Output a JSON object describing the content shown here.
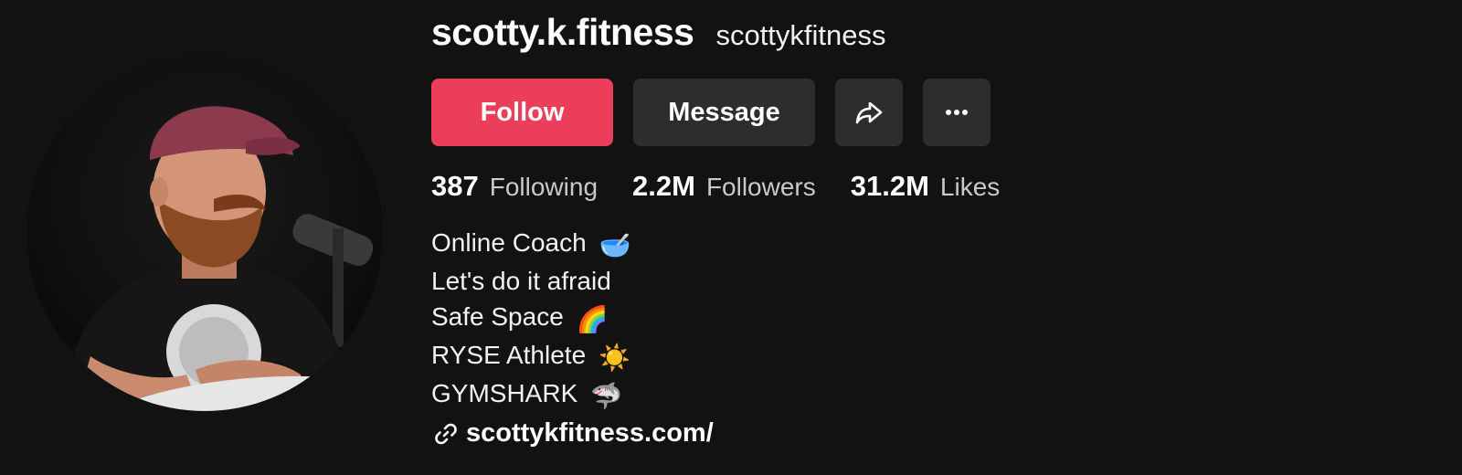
{
  "profile": {
    "display_name": "scotty.k.fitness",
    "handle": "scottykfitness",
    "avatar_icon": "profile-photo"
  },
  "actions": {
    "follow_label": "Follow",
    "message_label": "Message",
    "share_icon": "share-icon",
    "more_icon": "more-options-icon"
  },
  "stats": [
    {
      "value": "387",
      "label": "Following"
    },
    {
      "value": "2.2M",
      "label": "Followers"
    },
    {
      "value": "31.2M",
      "label": "Likes"
    }
  ],
  "bio": [
    {
      "text": "Online Coach",
      "emoji": "🥣"
    },
    {
      "text": "Let's do it afraid",
      "emoji": ""
    },
    {
      "text": "Safe Space",
      "emoji": "🌈"
    },
    {
      "text": "RYSE Athlete",
      "emoji": "☀️"
    },
    {
      "text": "GYMSHARK",
      "emoji": "🦈"
    }
  ],
  "link": {
    "text": "scottykfitness.com/",
    "icon": "link-icon"
  },
  "colors": {
    "background": "#121212",
    "follow_button": "#ea3e5b",
    "secondary_button": "#2d2d2d"
  }
}
